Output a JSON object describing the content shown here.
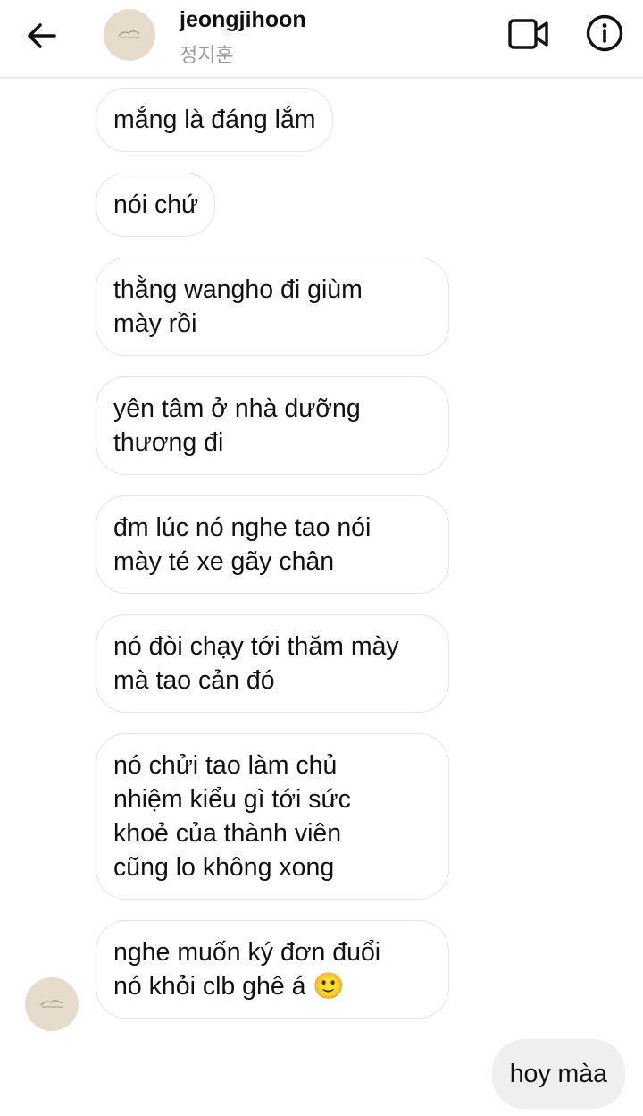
{
  "header": {
    "username": "jeongjihoon",
    "fullname": "정지훈"
  },
  "messages": [
    {
      "text": "mắng là đáng lắm"
    },
    {
      "text": "nói chứ"
    },
    {
      "text": "thằng wangho đi giùm\nmày rồi"
    },
    {
      "text": "yên tâm ở nhà dưỡng\nthương đi"
    },
    {
      "text": "đm lúc nó nghe tao nói\nmày té xe gãy chân"
    },
    {
      "text": "nó đòi chạy tới thăm mày\nmà tao cản đó"
    },
    {
      "text": "nó chửi tao làm chủ\nnhiệm kiểu gì tới sức\nkhoẻ của thành viên\ncũng lo không xong"
    },
    {
      "text": "nghe muốn ký đơn đuổi\nnó khỏi clb ghê á 🙂"
    }
  ],
  "sent_message": {
    "text": "hoy màa"
  },
  "icons": {
    "back": "arrow-left-icon",
    "video": "video-camera-icon",
    "info": "info-icon"
  },
  "colors": {
    "received_border": "#e4e4e4",
    "sent_bg": "#efefef",
    "avatar_bg": "#e6dccb"
  }
}
